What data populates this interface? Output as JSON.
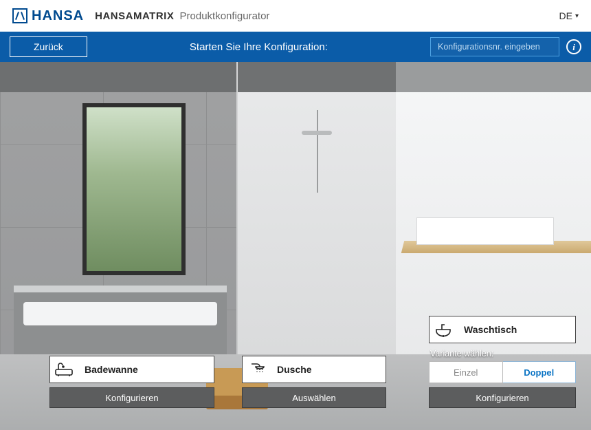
{
  "header": {
    "brand": "HANSA",
    "product_bold": "HANSAMATRIX",
    "product_sub": "Produktkonfigurator",
    "language": "DE"
  },
  "bluebar": {
    "back": "Zurück",
    "start": "Starten Sie Ihre Konfiguration:",
    "config_placeholder": "Konfigurationsnr. eingeben",
    "info_glyph": "i"
  },
  "cards": {
    "badewanne": {
      "title": "Badewanne",
      "action": "Konfigurieren"
    },
    "dusche": {
      "title": "Dusche",
      "action": "Auswählen"
    },
    "waschtisch": {
      "title": "Waschtisch",
      "variant_label": "Variante wählen:",
      "options": {
        "einzel": "Einzel",
        "doppel": "Doppel",
        "selected": "doppel"
      },
      "action": "Konfigurieren"
    }
  }
}
